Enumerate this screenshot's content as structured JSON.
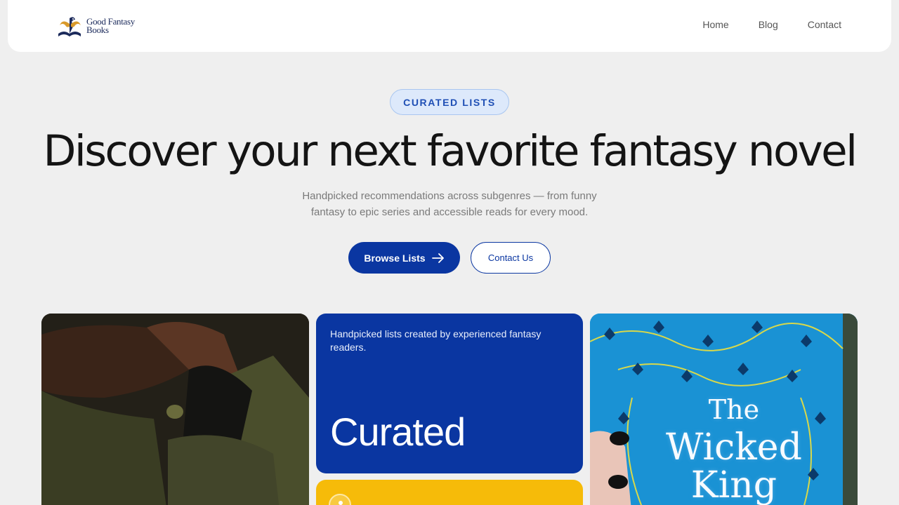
{
  "header": {
    "logo_line1": "Good Fantasy",
    "logo_line2": "Books",
    "nav": [
      "Home",
      "Blog",
      "Contact"
    ]
  },
  "hero": {
    "badge": "CURATED LISTS",
    "title": "Discover your next favorite fantasy novel",
    "subtitle_line1": "Handpicked recommendations across subgenres — from funny",
    "subtitle_line2": "fantasy to epic series and accessible reads for every mood.",
    "primary_button": "Browse Lists",
    "secondary_button": "Contact Us"
  },
  "cards": {
    "blue_text": "Handpicked lists created by experienced fantasy readers.",
    "blue_big": "Curated",
    "book_title_line1": "The",
    "book_title_line2": "Wicked",
    "book_title_line3": "King"
  },
  "colors": {
    "primary": "#0a36a1",
    "accent_yellow": "#f6bb09",
    "badge_bg": "#dde9fb",
    "background": "#efefef"
  }
}
